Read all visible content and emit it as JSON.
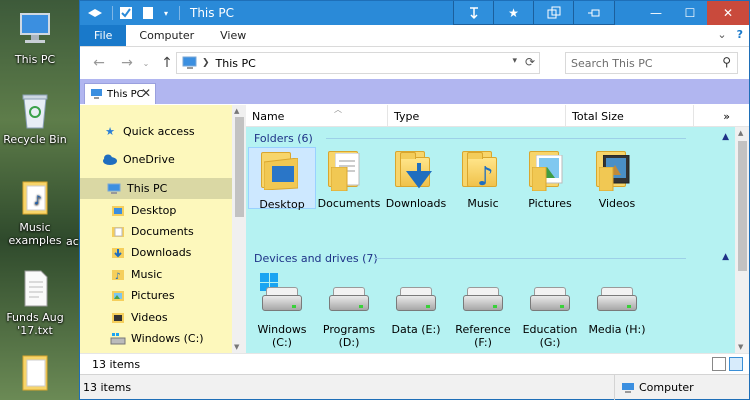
{
  "desktop": {
    "icons": [
      {
        "label": "This PC"
      },
      {
        "label": "Recycle Bin"
      },
      {
        "label": "Music examples"
      },
      {
        "label": "Funds Aug '17.txt"
      },
      {
        "label": "ac"
      }
    ]
  },
  "window": {
    "title": "This PC",
    "ribbon_tabs": {
      "file": "File",
      "computer": "Computer",
      "view": "View"
    },
    "address": {
      "path": "This PC"
    },
    "search": {
      "placeholder": "Search This PC"
    },
    "doc_tab": {
      "label": "This PC"
    },
    "columns": {
      "name": "Name",
      "type": "Type",
      "total_size": "Total Size"
    },
    "nav": {
      "items": [
        {
          "label": "Quick access"
        },
        {
          "label": "OneDrive"
        },
        {
          "label": "This PC"
        },
        {
          "label": "Desktop"
        },
        {
          "label": "Documents"
        },
        {
          "label": "Downloads"
        },
        {
          "label": "Music"
        },
        {
          "label": "Pictures"
        },
        {
          "label": "Videos"
        },
        {
          "label": "Windows (C:)"
        }
      ]
    },
    "folders_group": {
      "header": "Folders (6)"
    },
    "folders": [
      {
        "label": "Desktop"
      },
      {
        "label": "Documents"
      },
      {
        "label": "Downloads"
      },
      {
        "label": "Music"
      },
      {
        "label": "Pictures"
      },
      {
        "label": "Videos"
      }
    ],
    "drives_group": {
      "header": "Devices and drives (7)"
    },
    "drives": [
      {
        "label": "Windows (C:)"
      },
      {
        "label": "Programs (D:)"
      },
      {
        "label": "Data (E:)"
      },
      {
        "label": "Reference (F:)"
      },
      {
        "label": "Education (G:)"
      },
      {
        "label": "Media (H:)"
      }
    ],
    "status_inner": {
      "count": "13 items"
    },
    "status_outer": {
      "count": "13 items",
      "location": "Computer"
    }
  },
  "colors": {
    "titlebar": "#2a8ad8",
    "nav_bg": "#fdf8bc",
    "content_bg": "#b5f2f2",
    "tabstrip": "#b1b6f0",
    "group_text": "#1e3287"
  }
}
